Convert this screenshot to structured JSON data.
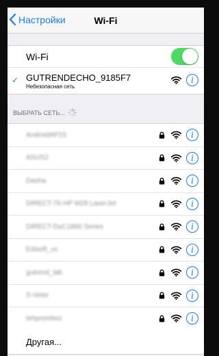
{
  "navbar": {
    "back_label": "Настройки",
    "title": "Wi-Fi"
  },
  "wifi_toggle": {
    "label": "Wi-Fi",
    "state": "on",
    "color": "#4cd964"
  },
  "current_network": {
    "ssid": "GUTRENDECHO_9185F7",
    "subtitle": "Небезопасная сеть",
    "check_icon": "checkmark-icon",
    "info_icon": "info-icon"
  },
  "section_header": "ВЫБРАТЬ СЕТЬ...",
  "networks": [
    {
      "name": "AndroidAP15",
      "secured": true
    },
    {
      "name": "ASUS2",
      "secured": true
    },
    {
      "name": "Dasha",
      "secured": true
    },
    {
      "name": "DIRECT-76-HP M28 LaserJet",
      "secured": true
    },
    {
      "name": "DIRECT-DyC1860 Series",
      "secured": true
    },
    {
      "name": "Edisoft_uc",
      "secured": true
    },
    {
      "name": "gutrend_lab",
      "secured": true
    },
    {
      "name": "S-Veter",
      "secured": true
    },
    {
      "name": "tehprombez",
      "secured": true
    }
  ],
  "other_label": "Другая...",
  "colors": {
    "accent": "#1a7cf5",
    "toggle_on": "#4cd964"
  }
}
